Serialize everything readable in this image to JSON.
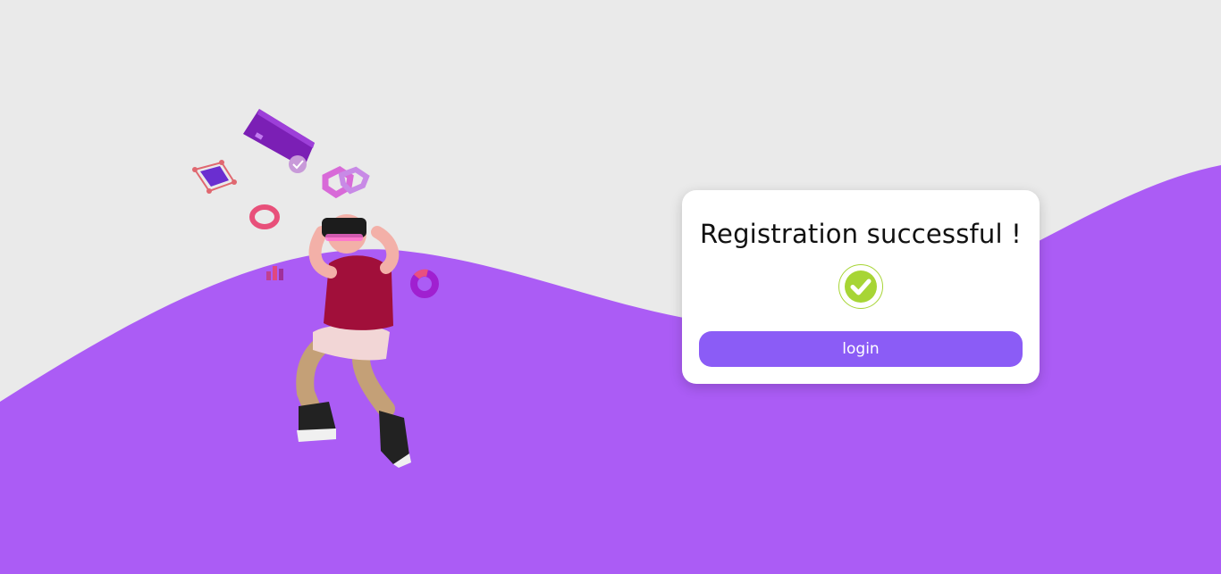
{
  "colors": {
    "background": "#eaeaea",
    "wave": "#ab5cf5",
    "card": "#ffffff",
    "button": "#8b5cf6",
    "check": "#a7d535"
  },
  "dialog": {
    "title": "Registration successful !",
    "status_icon": "check-circle-icon",
    "login_label": "login"
  },
  "illustration": {
    "icon": "vr-person-illustration"
  }
}
